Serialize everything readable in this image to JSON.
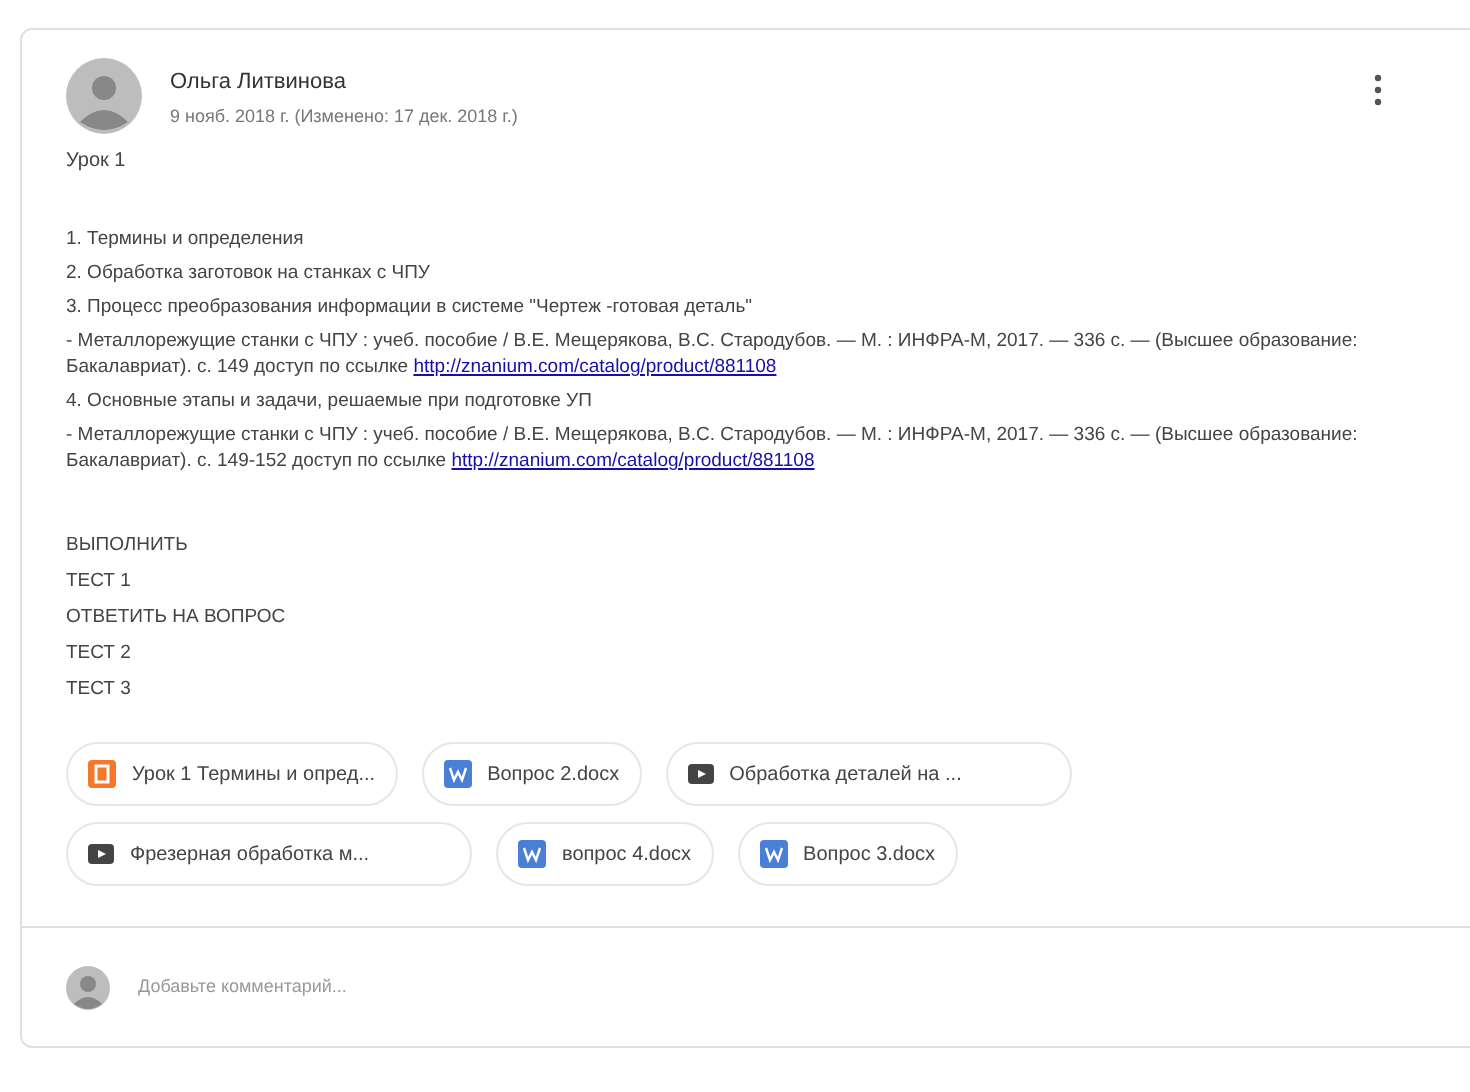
{
  "post": {
    "author": "Ольга Литвинова",
    "date": "9 нояб. 2018 г. (Изменено: 17 дек. 2018 г.)",
    "title": "Урок 1",
    "lines": [
      {
        "text": "1. Термины и определения"
      },
      {
        "text": "2. Обработка заготовок на станках с ЧПУ"
      },
      {
        "text": "3. Процесс преобразования информации в системе \"Чертеж -готовая деталь\""
      },
      {
        "text": "- Металлорежущие станки с ЧПУ : учеб. пособие / В.Е. Мещерякова, В.С. Стародубов. — М. : ИНФРА-М, 2017. — 336 с. — (Высшее образование: Бакалавриат). с. 149 доступ по ссылке ",
        "link": "http://znanium.com/catalog/product/881108"
      },
      {
        "text": "4. Основные этапы и задачи, решаемые при подготовке УП"
      },
      {
        "text": "- Металлорежущие станки с ЧПУ : учеб. пособие / В.Е. Мещерякова, В.С. Стародубов. — М. : ИНФРА-М, 2017. — 336 с. — (Высшее образование: Бакалавриат). с. 149-152 доступ по ссылке ",
        "link": "http://znanium.com/catalog/product/881108"
      }
    ],
    "tasks": [
      "ВЫПОЛНИТЬ",
      "ТЕСТ 1",
      "ОТВЕТИТЬ НА ВОПРОС",
      "ТЕСТ 2",
      "ТЕСТ 3"
    ],
    "attachments": [
      {
        "kind": "slides",
        "label": "Урок 1 Термины и опред..."
      },
      {
        "kind": "word",
        "label": "Вопрос 2.docx"
      },
      {
        "kind": "video",
        "label": "Обработка деталей на ..."
      },
      {
        "kind": "video",
        "label": "Фрезерная обработка м..."
      },
      {
        "kind": "word",
        "label": "вопрос 4.docx"
      },
      {
        "kind": "word",
        "label": "Вопрос 3.docx"
      }
    ],
    "comment": {
      "placeholder": "Добавьте комментарий..."
    }
  }
}
